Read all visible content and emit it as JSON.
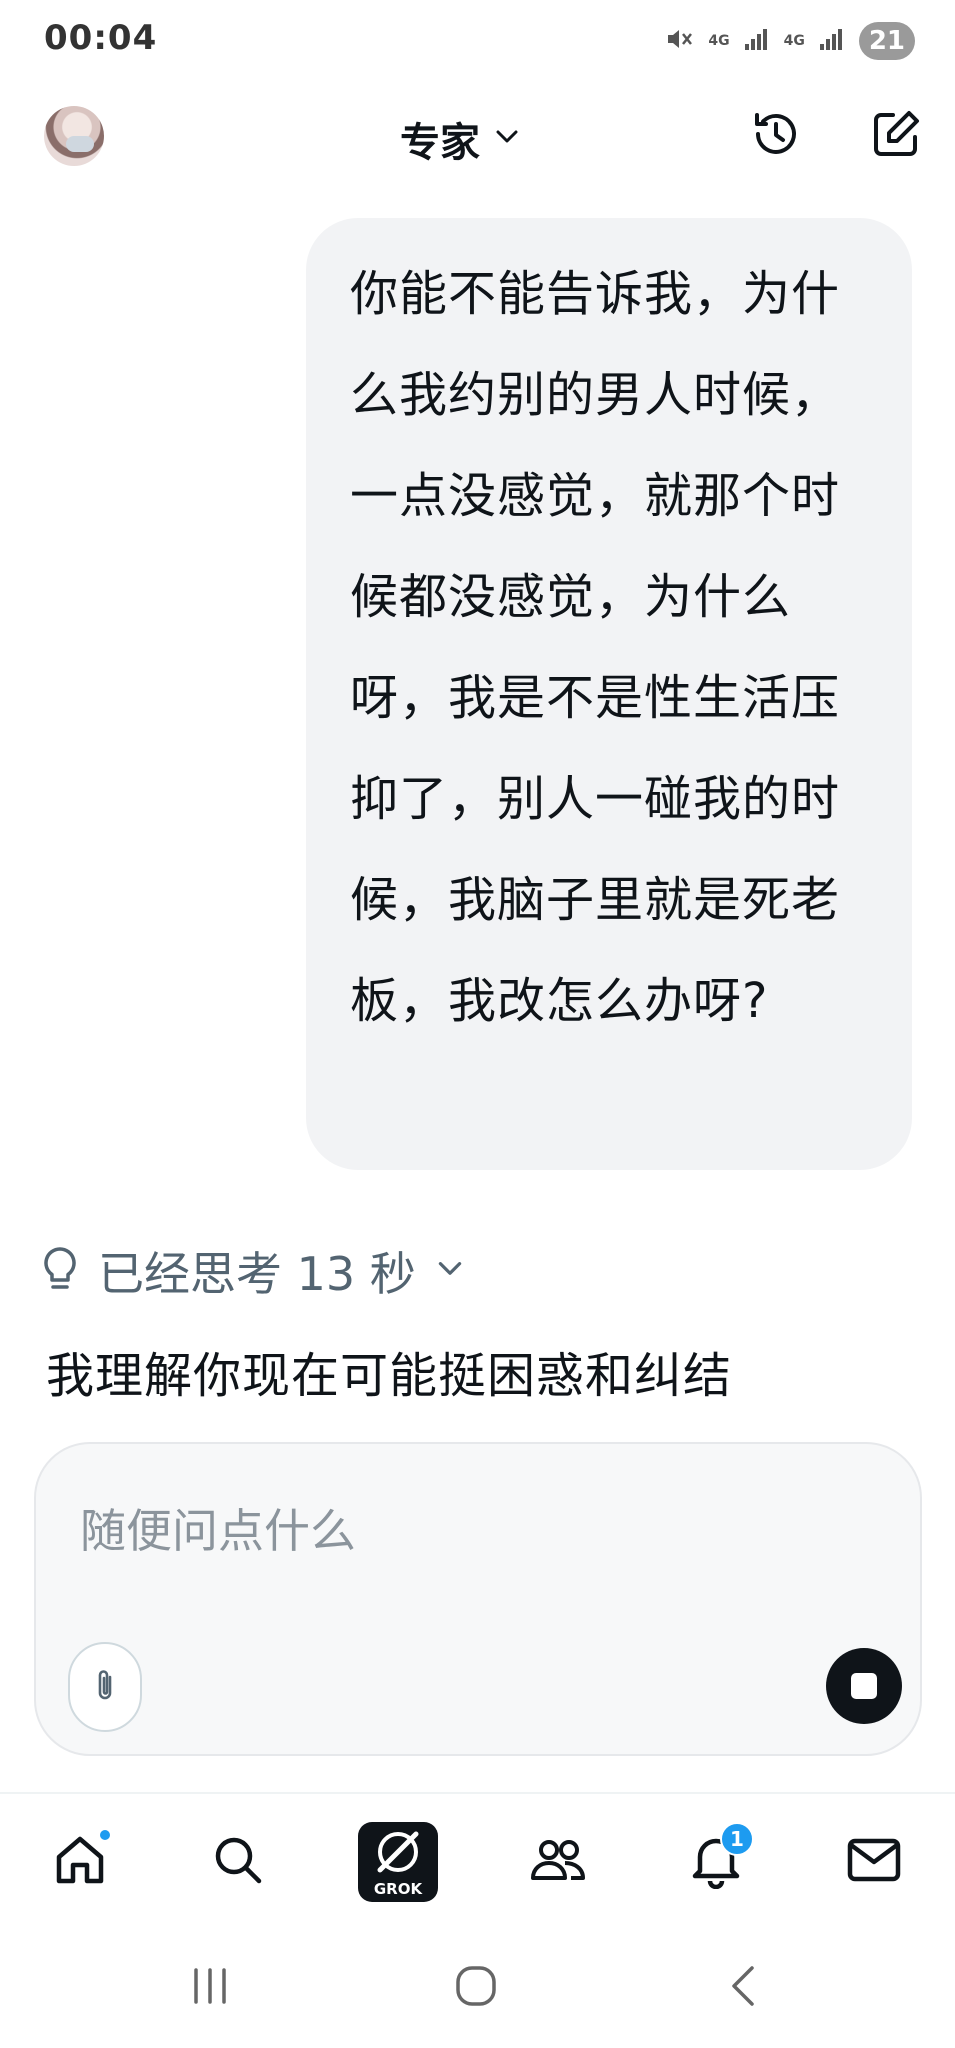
{
  "status_bar": {
    "time": "00:04",
    "battery": "21",
    "net1": "4G",
    "net2": "4G"
  },
  "header": {
    "model_label": "专家",
    "icons": [
      "avatar",
      "chevron-down-icon",
      "history-icon",
      "compose-icon"
    ]
  },
  "conversation": {
    "user_message": "你能不能告诉我，为什么我约别的男人时候，一点没感觉，就那个时候都没感觉，为什么呀，我是不是性生活压抑了，别人一碰我的时候，我脑子里就是死老板，我改怎么办呀?",
    "thinking_label": "已经思考 13 秒",
    "answer_text": "我理解你现在可能挺困惑和纠结"
  },
  "composer": {
    "placeholder": "随便问点什么"
  },
  "bottom_nav": {
    "grok_label": "GROK",
    "notification_count": "1",
    "accent": "#1d9bf0"
  }
}
